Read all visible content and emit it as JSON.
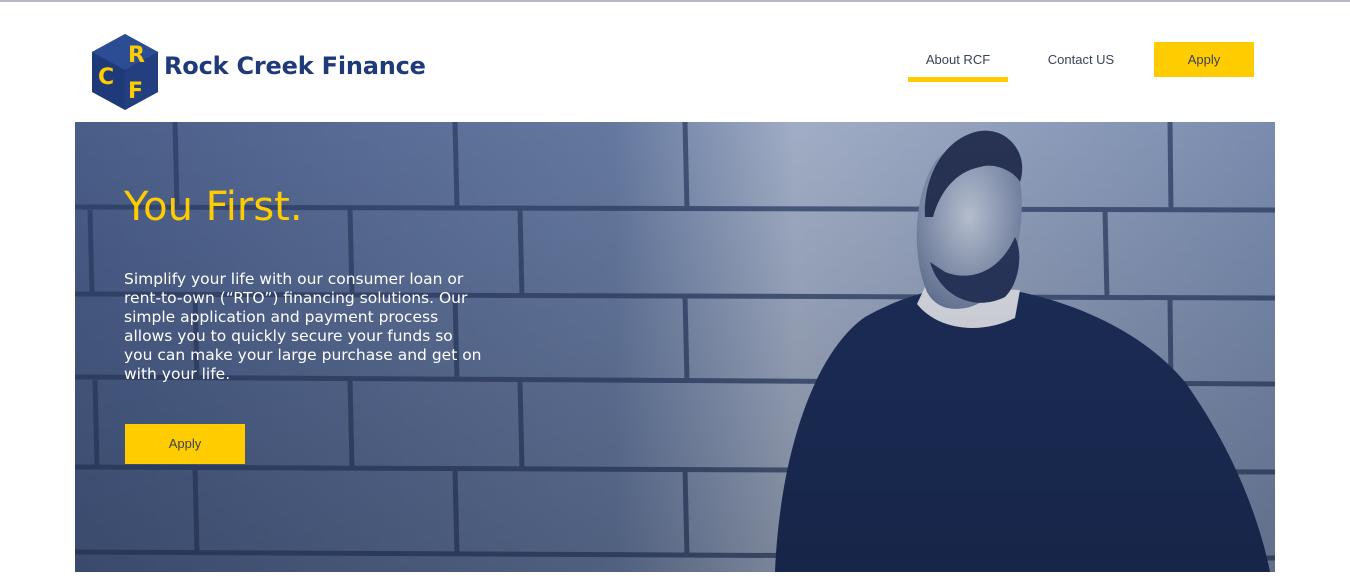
{
  "header": {
    "brand_name": "Rock Creek Finance",
    "logo_letters": [
      "R",
      "C",
      "F"
    ]
  },
  "nav": {
    "items": [
      {
        "label": "About RCF",
        "active": true
      },
      {
        "label": "Contact US",
        "active": false
      }
    ],
    "apply_label": "Apply"
  },
  "hero": {
    "title": "You First.",
    "body": "Simplify your life with our consumer loan or rent-to-own (“RTO”) financing solutions. Our simple application and payment process allows you to quickly secure your funds so you can make your large purchase and get on with your life.",
    "apply_label": "Apply"
  },
  "colors": {
    "brand_blue": "#1f3a78",
    "accent_yellow": "#ffcc00",
    "nav_text": "#3a4356",
    "hero_tint": "#5a6f9a"
  }
}
